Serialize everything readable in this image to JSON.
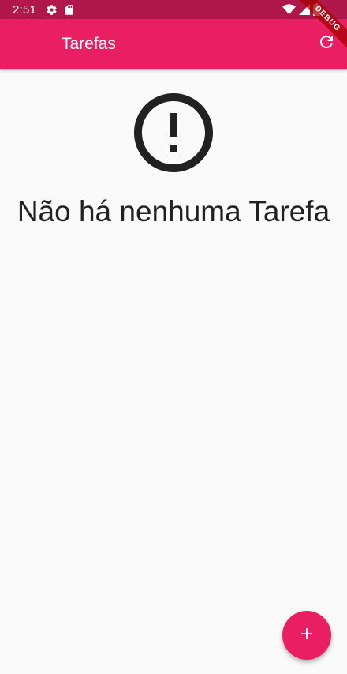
{
  "status_bar": {
    "time": "2:51",
    "icons": [
      "gear-icon",
      "sd-card-icon",
      "wifi-icon",
      "signal-icon",
      "battery-icon"
    ]
  },
  "app_bar": {
    "title": "Tarefas",
    "action_icon": "refresh-icon"
  },
  "debug_banner": {
    "label": "DEBUG"
  },
  "empty_state": {
    "icon": "error-outline-icon",
    "message": "Não há nenhuma Tarefa"
  },
  "fab": {
    "icon": "add-icon"
  },
  "colors": {
    "primary": "#e91e63",
    "status_bar": "#b0174a",
    "background": "#fafafa",
    "text": "#212121"
  }
}
